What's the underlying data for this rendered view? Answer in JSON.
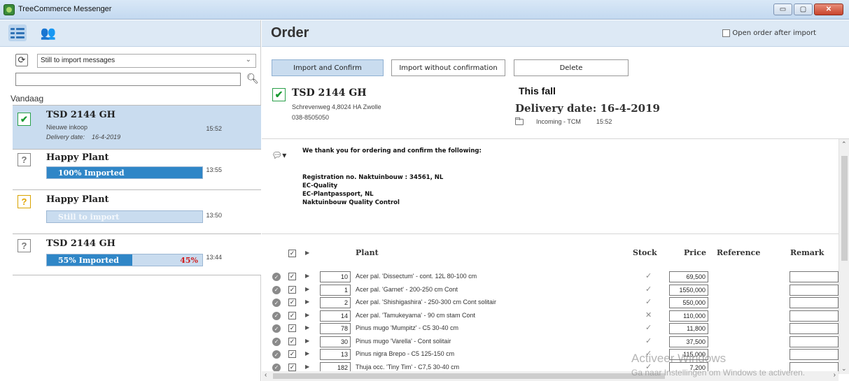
{
  "window": {
    "title": "TreeCommerce Messenger",
    "min_label": "▭",
    "max_label": "▢",
    "close_label": "✕"
  },
  "left": {
    "icons": [
      "list-icon",
      "users-icon"
    ],
    "filter": {
      "value": "Still to import messages"
    },
    "search": {
      "placeholder": ""
    },
    "group_label": "Vandaag",
    "messages": [
      {
        "title": "TSD 2144 GH",
        "subtitle": "Nieuwe inkoop",
        "delivery_label": "Delivery date:",
        "delivery_date": "16-4-2019",
        "time": "15:52",
        "status": "imported"
      },
      {
        "title": "Happy Plant",
        "progress_label": "100% Imported",
        "progress": 1.0,
        "time": "13:55",
        "status": "unknown"
      },
      {
        "title": "Happy Plant",
        "progress_label": "Still to import",
        "progress": 0,
        "time": "13:50",
        "status": "pending"
      },
      {
        "title": "TSD 2144 GH",
        "progress_label": "55% Imported",
        "progress": 0.55,
        "remaining_label": "45%",
        "time": "13:44",
        "status": "unknown"
      }
    ]
  },
  "order": {
    "title": "Order",
    "open_after_import_label": "Open order after import",
    "buttons": {
      "import_confirm": "Import and Confirm",
      "import_no_confirm": "Import without confirmation",
      "delete": "Delete"
    },
    "customer": {
      "name": "TSD 2144 GH",
      "address": "Schrevenweg 4,8024 HA Zwolle",
      "phone": "038-8505050"
    },
    "this_fall": "This fall",
    "delivery": "Delivery date: 16-4-2019",
    "incoming_folder": "Incoming - TCM",
    "incoming_time": "15:52",
    "comment": {
      "line1": "We thank you for ordering and confirm the following:",
      "line2": "Registration no. Naktuinbouw : 34561, NL",
      "line3": "EC-Quality",
      "line4": "EC-Plantpassport, NL",
      "line5": "Naktuinbouw Quality Control"
    },
    "table": {
      "headers": {
        "plant": "Plant",
        "stock": "Stock",
        "price": "Price",
        "reference": "Reference",
        "remark": "Remark"
      },
      "rows": [
        {
          "qty": "10",
          "plant": "Acer pal. 'Dissectum' - cont. 12L 80-100 cm",
          "stock": "✓",
          "price": "69,500"
        },
        {
          "qty": "1",
          "plant": "Acer pal. 'Garnet' - 200-250 cm Cont",
          "stock": "✓",
          "price": "1550,000"
        },
        {
          "qty": "2",
          "plant": "Acer pal. 'Shishigashira' - 250-300 cm Cont solitair",
          "stock": "✓",
          "price": "550,000"
        },
        {
          "qty": "14",
          "plant": "Acer pal. 'Tamukeyama' - 90 cm stam Cont",
          "stock": "✕",
          "price": "110,000"
        },
        {
          "qty": "78",
          "plant": "Pinus mugo 'Mumpitz' - C5 30-40 cm",
          "stock": "✓",
          "price": "11,800"
        },
        {
          "qty": "30",
          "plant": "Pinus mugo 'Varella' - Cont solitair",
          "stock": "✓",
          "price": "37,500"
        },
        {
          "qty": "13",
          "plant": "Pinus nigra Brepo - C5 125-150 cm",
          "stock": "✓",
          "price": "115,000"
        },
        {
          "qty": "182",
          "plant": "Thuja occ. 'Tiny Tim' - C7,5 30-40 cm",
          "stock": "✓",
          "price": "7,200"
        }
      ]
    }
  },
  "watermark": {
    "line1": "Activeer Windows",
    "line2": "Ga naar Instellingen om Windows te activeren."
  }
}
